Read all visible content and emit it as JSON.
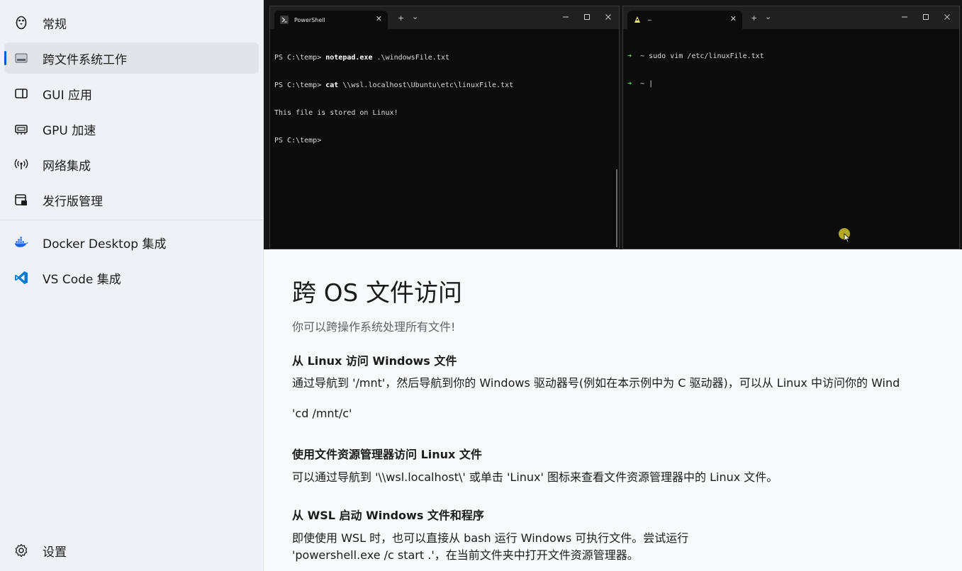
{
  "sidebar": {
    "items": [
      {
        "label": "常规",
        "icon": "penguin-icon"
      },
      {
        "label": "跨文件系统工作",
        "icon": "folder-drive-icon"
      },
      {
        "label": "GUI 应用",
        "icon": "window-icon"
      },
      {
        "label": "GPU 加速",
        "icon": "chip-icon"
      },
      {
        "label": "网络集成",
        "icon": "antenna-icon"
      },
      {
        "label": "发行版管理",
        "icon": "distro-manage-icon"
      },
      {
        "label": "Docker Desktop 集成",
        "icon": "docker-icon"
      },
      {
        "label": "VS Code 集成",
        "icon": "vscode-icon"
      }
    ],
    "settings_label": "设置",
    "selected_index": 1
  },
  "screenshot": {
    "left_terminal": {
      "tab_title": "PowerShell",
      "lines": [
        {
          "prompt": "PS C:\\temp> ",
          "cmd": "notepad.exe",
          "args": " .\\windowsFile.txt"
        },
        {
          "prompt": "PS C:\\temp> ",
          "cmd": "cat",
          "args": " \\\\wsl.localhost\\Ubuntu\\etc\\linuxFile.txt"
        },
        {
          "prompt": "",
          "cmd": "",
          "args": "This file is stored on Linux!"
        },
        {
          "prompt": "PS C:\\temp> ",
          "cmd": "",
          "args": ""
        }
      ]
    },
    "right_terminal": {
      "tab_title": "~",
      "lines": [
        {
          "arrow": "➜",
          "text": "  ~ sudo vim /etc/linuxFile.txt"
        },
        {
          "arrow": "➜",
          "text": "  ~ |"
        }
      ]
    },
    "new_tab_label": "+",
    "dropdown_label": "⌄"
  },
  "content": {
    "title": "跨 OS 文件访问",
    "subtitle": "你可以跨操作系统处理所有文件!",
    "sections": [
      {
        "title": "从 Linux 访问 Windows 文件",
        "text": "通过导航到 '/mnt'，然后导航到你的 Windows 驱动器号(例如在本示例中为 C 驱动器)，可以从 Linux 中访问你的 Wind",
        "code": "'cd /mnt/c'"
      },
      {
        "title": "使用文件资源管理器访问 Linux 文件",
        "text": "可以通过导航到 '\\\\wsl.localhost\\' 或单击 'Linux' 图标来查看文件资源管理器中的 Linux 文件。"
      },
      {
        "title": "从 WSL 启动 Windows 文件和程序",
        "text": "即使使用 WSL 时，也可以直接从 bash 运行 Windows 可执行文件。尝试运行",
        "text2": "'powershell.exe /c start .'，在当前文件夹中打开文件资源管理器。"
      }
    ]
  },
  "colors": {
    "accent": "#005fb8",
    "docker": "#1d63ed",
    "vscode": "#0078d4"
  }
}
